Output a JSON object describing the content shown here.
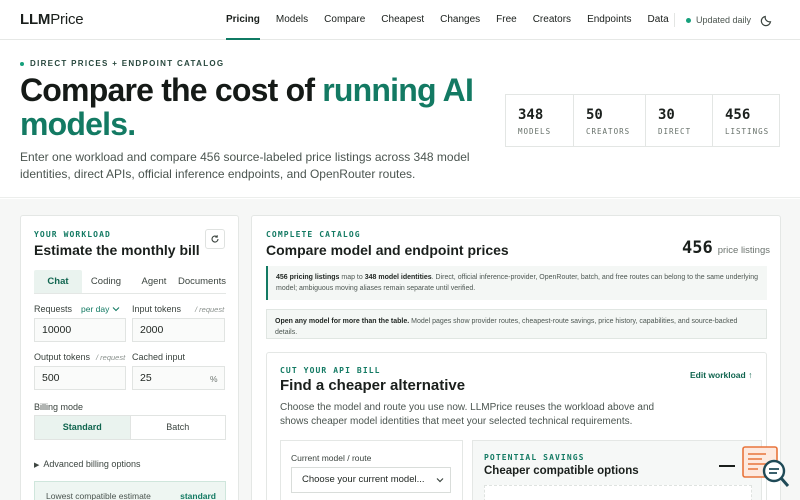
{
  "brand": {
    "part1": "LLM",
    "part2": "Price"
  },
  "nav": {
    "links": [
      "Pricing",
      "Models",
      "Compare",
      "Cheapest",
      "Changes",
      "Free",
      "Creators",
      "Endpoints",
      "Data"
    ],
    "active": "Pricing",
    "updated": "Updated daily",
    "theme_icon": "moon-icon"
  },
  "hero": {
    "eyebrow": "DIRECT PRICES + ENDPOINT CATALOG",
    "title_plain": "Compare the cost of ",
    "title_accent": "running AI models.",
    "description": "Enter one workload and compare 456 source-labeled price listings across 348 model identities, direct APIs, official inference endpoints, and OpenRouter routes.",
    "stats": [
      {
        "value": "348",
        "label": "MODELS"
      },
      {
        "value": "50",
        "label": "CREATORS"
      },
      {
        "value": "30",
        "label": "DIRECT"
      },
      {
        "value": "456",
        "label": "LISTINGS"
      }
    ]
  },
  "workload": {
    "section": "YOUR WORKLOAD",
    "title": "Estimate the monthly bill",
    "tabs": [
      "Chat",
      "Coding",
      "Agent",
      "Documents"
    ],
    "active_tab": "Chat",
    "requests_label": "Requests",
    "requests_unit": "per day",
    "requests_value": "10000",
    "input_tokens_label": "Input tokens",
    "input_tokens_hint": "/ request",
    "input_tokens_value": "2000",
    "output_tokens_label": "Output tokens",
    "output_tokens_hint": "/ request",
    "output_tokens_value": "500",
    "cached_input_label": "Cached input",
    "cached_input_value": "25",
    "cached_input_unit": "%",
    "billing_mode_label": "Billing mode",
    "billing_modes": [
      "Standard",
      "Batch"
    ],
    "active_billing_mode": "Standard",
    "advanced": "Advanced billing options",
    "lowest_label": "Lowest compatible estimate",
    "lowest_value": "standard"
  },
  "catalog": {
    "section": "COMPLETE CATALOG",
    "title": "Compare model and endpoint prices",
    "count": "456",
    "count_label": "price listings",
    "note1_b1": "456 pricing listings",
    "note1_t1": " map to ",
    "note1_b2": "348 model identities",
    "note1_t2": ". Direct, official inference-provider, OpenRouter, batch, and free routes can belong to the same underlying model; ambiguous moving aliases remain separate until verified.",
    "note2_b": "Open any model for more than the table.",
    "note2_t": " Model pages show provider routes, cheapest-route savings, price history, capabilities, and source-backed details."
  },
  "cheaper": {
    "section": "CUT YOUR API BILL",
    "title": "Find a cheaper alternative",
    "description": "Choose the model and route you use now. LLMPrice reuses the workload above and shows cheaper model identities that meet your selected technical requirements.",
    "edit_label": "Edit workload ↑",
    "current_label": "Current model / route",
    "select_value": "Choose your current model...",
    "potential_section": "POTENTIAL SAVINGS",
    "potential_title": "Cheaper compatible options"
  },
  "colors": {
    "accent": "#137a63",
    "accent_bg": "#eaf3ef",
    "widget": "#e8743b"
  }
}
